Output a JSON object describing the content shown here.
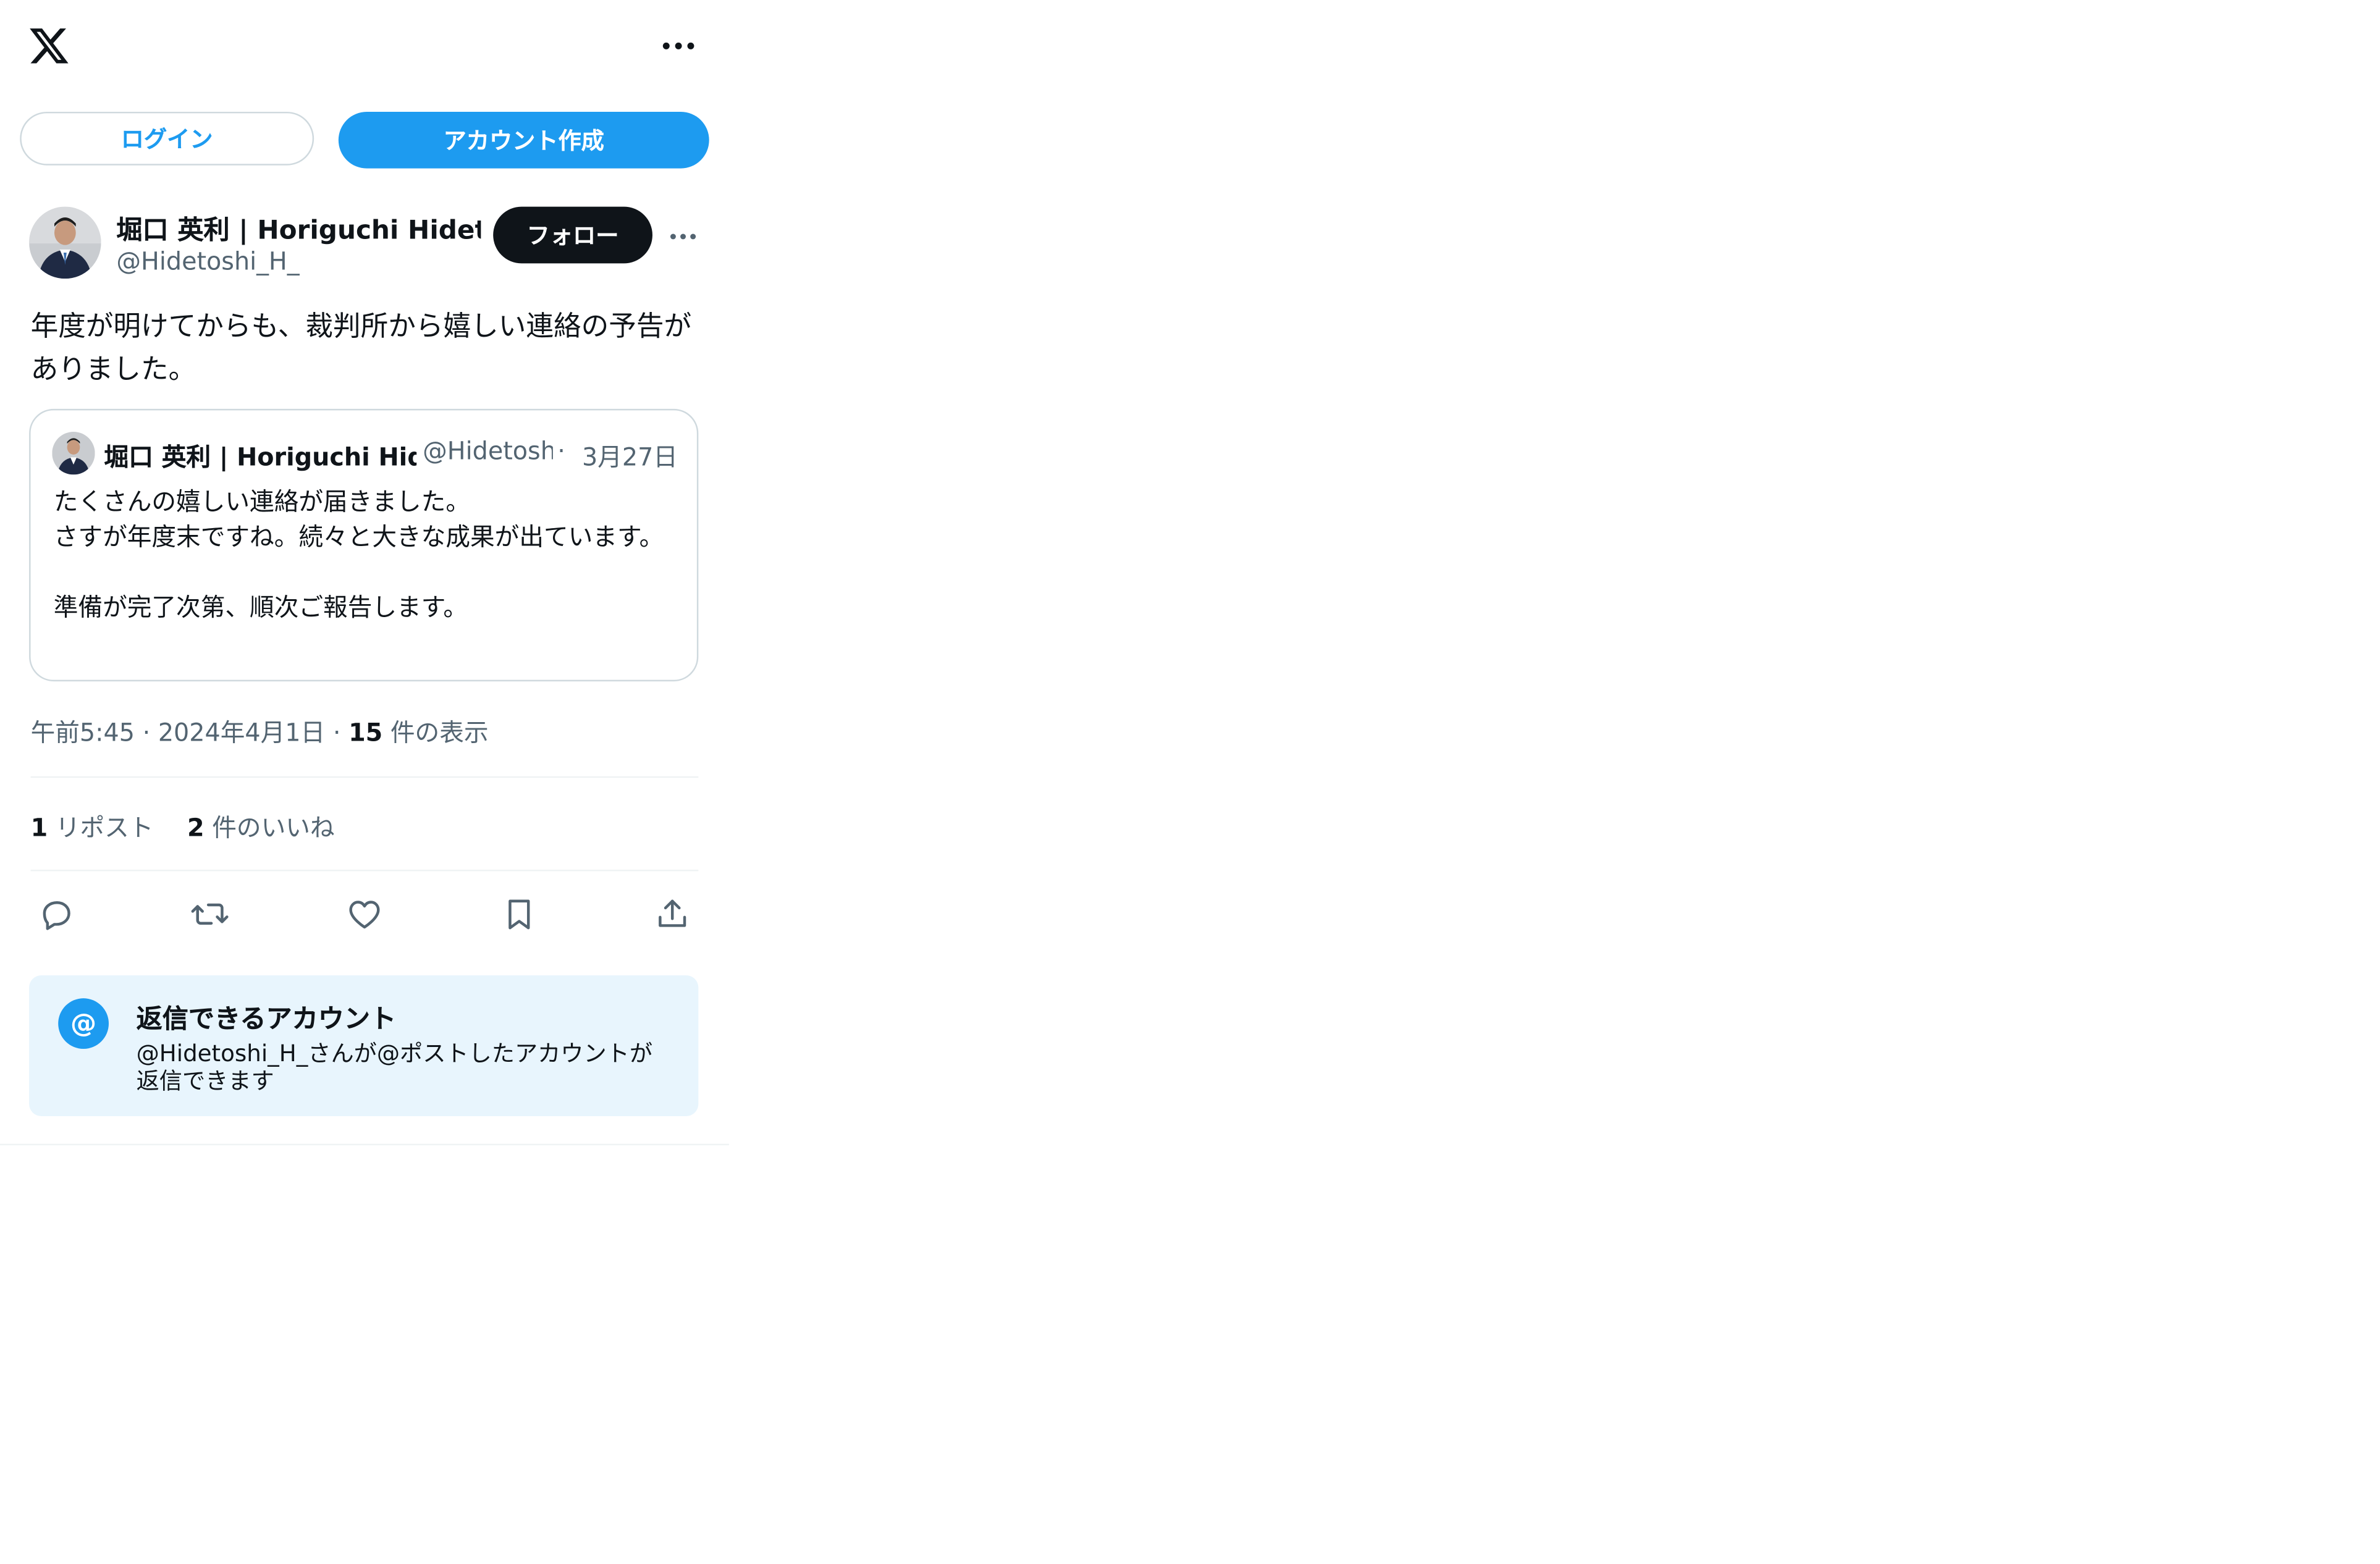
{
  "header": {
    "logo_icon": "x-logo-icon",
    "more_icon": "more-horizontal-icon"
  },
  "auth": {
    "login_label": "ログイン",
    "signup_label": "アカウント作成"
  },
  "tweet": {
    "author_name": "堀口 英利 | Horiguchi Hidetoshi",
    "author_handle": "@Hidetoshi_H_",
    "follow_label": "フォロー",
    "text": "年度が明けてからも、裁判所から嬉しい連絡の予告がありました。",
    "time": "午前5:45",
    "date": "2024年4月1日",
    "views_count": "15",
    "views_label": "件の表示",
    "reposts_count": "1",
    "reposts_label": "リポスト",
    "likes_count": "2",
    "likes_label": "件のいいね"
  },
  "quote": {
    "author_name": "堀口 英利 | Horiguchi Hidetoshi",
    "author_handle": "@Hidetoshi_H_",
    "separator": "·",
    "date": "3月27日",
    "text": "たくさんの嬉しい連絡が届きました。\nさすが年度末ですね。続々と大きな成果が出ています。\n\n準備が完了次第、順次ご報告します。"
  },
  "actions": {
    "reply_icon": "reply-icon",
    "repost_icon": "repost-icon",
    "like_icon": "heart-icon",
    "bookmark_icon": "bookmark-icon",
    "share_icon": "share-icon"
  },
  "reply_settings": {
    "icon": "@",
    "title": "返信できるアカウント",
    "description": "@Hidetoshi_H_さんが@ポストしたアカウントが返信できます"
  },
  "colors": {
    "accent": "#1d9bf0",
    "text_primary": "#0f1419",
    "text_secondary": "#536471",
    "border": "#cfd9de",
    "reply_bg": "#e8f5fd"
  }
}
